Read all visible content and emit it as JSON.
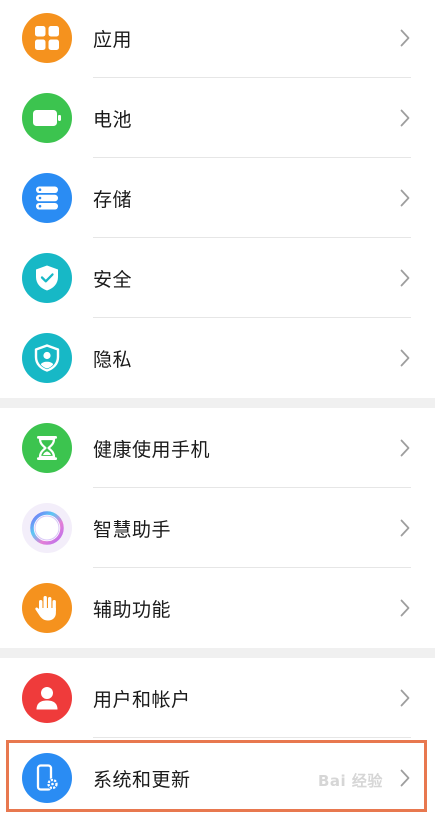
{
  "settings": {
    "group1": [
      {
        "label": "应用",
        "icon": "apps-grid-icon",
        "color": "#f5921e"
      },
      {
        "label": "电池",
        "icon": "battery-icon",
        "color": "#3cc44f"
      },
      {
        "label": "存储",
        "icon": "storage-icon",
        "color": "#2a8cf3"
      },
      {
        "label": "安全",
        "icon": "shield-check-icon",
        "color": "#17b8c6"
      },
      {
        "label": "隐私",
        "icon": "privacy-shield-icon",
        "color": "#17b8c6"
      }
    ],
    "group2": [
      {
        "label": "健康使用手机",
        "icon": "hourglass-icon",
        "color": "#3cc44f"
      },
      {
        "label": "智慧助手",
        "icon": "assistant-ring-icon",
        "color": "#f3eefa"
      },
      {
        "label": "辅助功能",
        "icon": "hand-icon",
        "color": "#f5921e"
      }
    ],
    "group3": [
      {
        "label": "用户和帐户",
        "icon": "user-icon",
        "color": "#ef3b3b"
      },
      {
        "label": "系统和更新",
        "icon": "phone-gear-icon",
        "color": "#2a8cf3"
      }
    ]
  },
  "highlight_color": "#e8784f",
  "watermark": "Bai 经验"
}
